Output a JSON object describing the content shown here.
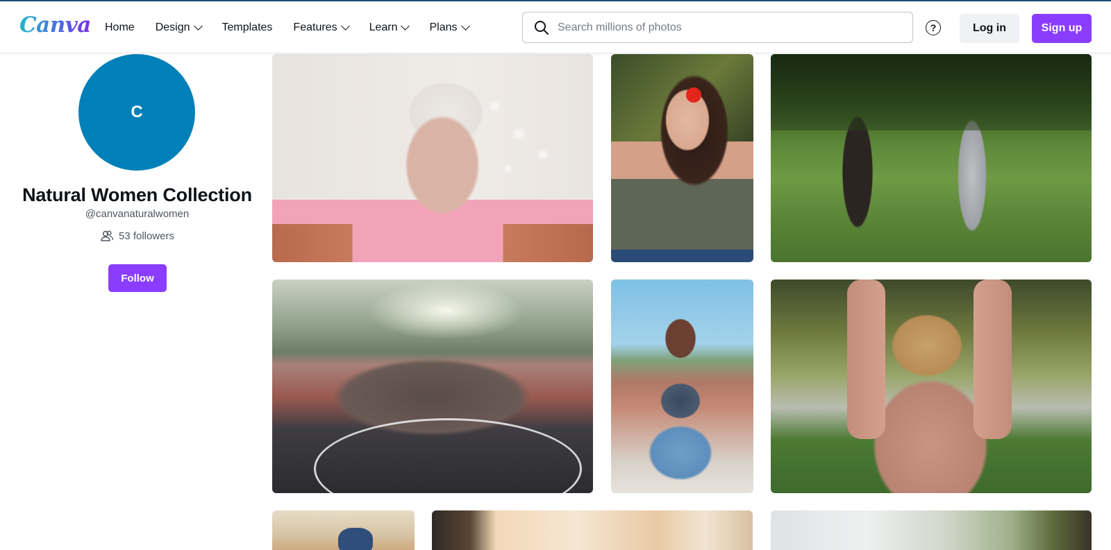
{
  "header": {
    "logo": "Canva",
    "nav": [
      {
        "label": "Home",
        "has_dropdown": false
      },
      {
        "label": "Design",
        "has_dropdown": true
      },
      {
        "label": "Templates",
        "has_dropdown": false
      },
      {
        "label": "Features",
        "has_dropdown": true
      },
      {
        "label": "Learn",
        "has_dropdown": true
      },
      {
        "label": "Plans",
        "has_dropdown": true
      }
    ],
    "search": {
      "placeholder": "Search millions of photos",
      "value": ""
    },
    "help_label": "?",
    "login_label": "Log in",
    "signup_label": "Sign up"
  },
  "profile": {
    "avatar_letter": "C",
    "name": "Natural Women Collection",
    "handle": "@canvanaturalwomen",
    "followers": "53 followers",
    "follow_label": "Follow"
  },
  "colors": {
    "brand_purple": "#8b3dff",
    "avatar_blue": "#0080b8",
    "text_primary": "#0e1318",
    "text_secondary": "#4f5660"
  },
  "icons": {
    "search": "search-icon",
    "help": "help-icon",
    "followers": "followers-icon",
    "dropdown": "chevron-down-icon"
  }
}
